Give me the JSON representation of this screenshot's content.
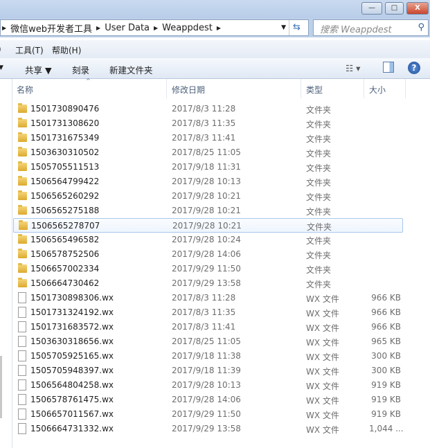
{
  "window": {
    "minimize": "—",
    "maximize": "□",
    "close": "X"
  },
  "address": {
    "crumbs": [
      "微信web开发者工具",
      "User Data",
      "Weappdest"
    ],
    "search_placeholder": "搜索 Weappdest"
  },
  "menu": {
    "items": [
      "工具(T)",
      "帮助(H)"
    ]
  },
  "toolbar": {
    "share": "共享 ▼",
    "burn": "刻录",
    "new_folder": "新建文件夹",
    "help": "?"
  },
  "columns": {
    "name": "名称",
    "date": "修改日期",
    "type": "类型",
    "size": "大小"
  },
  "files": [
    {
      "name": "1501730890476",
      "date": "2017/8/3 11:28",
      "type": "文件夹",
      "size": "",
      "kind": "folder"
    },
    {
      "name": "1501731308620",
      "date": "2017/8/3 11:35",
      "type": "文件夹",
      "size": "",
      "kind": "folder"
    },
    {
      "name": "1501731675349",
      "date": "2017/8/3 11:41",
      "type": "文件夹",
      "size": "",
      "kind": "folder"
    },
    {
      "name": "1503630310502",
      "date": "2017/8/25 11:05",
      "type": "文件夹",
      "size": "",
      "kind": "folder"
    },
    {
      "name": "1505705511513",
      "date": "2017/9/18 11:31",
      "type": "文件夹",
      "size": "",
      "kind": "folder"
    },
    {
      "name": "1506564799422",
      "date": "2017/9/28 10:13",
      "type": "文件夹",
      "size": "",
      "kind": "folder"
    },
    {
      "name": "1506565260292",
      "date": "2017/9/28 10:21",
      "type": "文件夹",
      "size": "",
      "kind": "folder"
    },
    {
      "name": "1506565275188",
      "date": "2017/9/28 10:21",
      "type": "文件夹",
      "size": "",
      "kind": "folder"
    },
    {
      "name": "1506565278707",
      "date": "2017/9/28 10:21",
      "type": "文件夹",
      "size": "",
      "kind": "folder",
      "hover": true
    },
    {
      "name": "1506565496582",
      "date": "2017/9/28 10:24",
      "type": "文件夹",
      "size": "",
      "kind": "folder"
    },
    {
      "name": "1506578752506",
      "date": "2017/9/28 14:06",
      "type": "文件夹",
      "size": "",
      "kind": "folder"
    },
    {
      "name": "1506657002334",
      "date": "2017/9/29 11:50",
      "type": "文件夹",
      "size": "",
      "kind": "folder"
    },
    {
      "name": "1506664730462",
      "date": "2017/9/29 13:58",
      "type": "文件夹",
      "size": "",
      "kind": "folder"
    },
    {
      "name": "1501730898306.wx",
      "date": "2017/8/3 11:28",
      "type": "WX 文件",
      "size": "966 KB",
      "kind": "file"
    },
    {
      "name": "1501731324192.wx",
      "date": "2017/8/3 11:35",
      "type": "WX 文件",
      "size": "966 KB",
      "kind": "file"
    },
    {
      "name": "1501731683572.wx",
      "date": "2017/8/3 11:41",
      "type": "WX 文件",
      "size": "966 KB",
      "kind": "file"
    },
    {
      "name": "1503630318656.wx",
      "date": "2017/8/25 11:05",
      "type": "WX 文件",
      "size": "965 KB",
      "kind": "file"
    },
    {
      "name": "1505705925165.wx",
      "date": "2017/9/18 11:38",
      "type": "WX 文件",
      "size": "300 KB",
      "kind": "file"
    },
    {
      "name": "1505705948397.wx",
      "date": "2017/9/18 11:39",
      "type": "WX 文件",
      "size": "300 KB",
      "kind": "file"
    },
    {
      "name": "1506564804258.wx",
      "date": "2017/9/28 10:13",
      "type": "WX 文件",
      "size": "919 KB",
      "kind": "file"
    },
    {
      "name": "1506578761475.wx",
      "date": "2017/9/28 14:06",
      "type": "WX 文件",
      "size": "919 KB",
      "kind": "file"
    },
    {
      "name": "1506657011567.wx",
      "date": "2017/9/29 11:50",
      "type": "WX 文件",
      "size": "919 KB",
      "kind": "file"
    },
    {
      "name": "1506664731332.wx",
      "date": "2017/9/29 13:58",
      "type": "WX 文件",
      "size": "1,044 ...",
      "kind": "file"
    }
  ]
}
